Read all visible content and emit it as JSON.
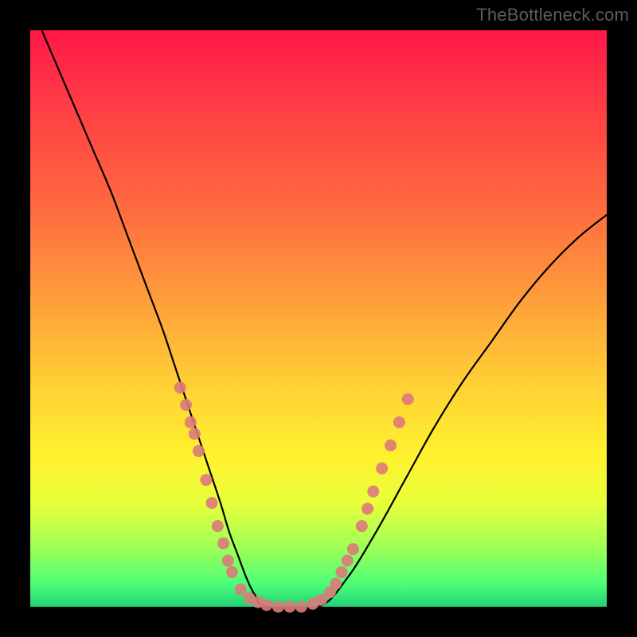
{
  "watermark": "TheBottleneck.com",
  "colors": {
    "frame": "#000000",
    "gradient_top": "#ff1848",
    "gradient_bottom": "#22d276",
    "curve": "#000000",
    "marker": "#db7a7a"
  },
  "chart_data": {
    "type": "line",
    "title": "",
    "xlabel": "",
    "ylabel": "",
    "xlim": [
      0,
      100
    ],
    "ylim": [
      0,
      100
    ],
    "series": [
      {
        "name": "curve",
        "x": [
          2,
          5,
          8,
          11,
          14,
          17,
          20,
          23,
          25,
          27,
          29,
          31,
          33,
          34.5,
          36,
          37.5,
          39,
          41,
          50,
          55,
          60,
          65,
          70,
          75,
          80,
          85,
          90,
          95,
          100
        ],
        "y": [
          100,
          93,
          86,
          79,
          72,
          64,
          56,
          48,
          42,
          36,
          30,
          24,
          18,
          13,
          9,
          5,
          2,
          0,
          0,
          5,
          13,
          22,
          31,
          39,
          46,
          53,
          59,
          64,
          68
        ]
      }
    ],
    "markers": [
      {
        "x": 26.0,
        "y": 38
      },
      {
        "x": 27.0,
        "y": 35
      },
      {
        "x": 27.8,
        "y": 32
      },
      {
        "x": 28.5,
        "y": 30
      },
      {
        "x": 29.2,
        "y": 27
      },
      {
        "x": 30.5,
        "y": 22
      },
      {
        "x": 31.5,
        "y": 18
      },
      {
        "x": 32.5,
        "y": 14
      },
      {
        "x": 33.5,
        "y": 11
      },
      {
        "x": 34.3,
        "y": 8
      },
      {
        "x": 35.0,
        "y": 6
      },
      {
        "x": 36.5,
        "y": 3
      },
      {
        "x": 38.0,
        "y": 1.5
      },
      {
        "x": 39.5,
        "y": 0.8
      },
      {
        "x": 41.0,
        "y": 0.3
      },
      {
        "x": 43.0,
        "y": 0
      },
      {
        "x": 45.0,
        "y": 0
      },
      {
        "x": 47.0,
        "y": 0
      },
      {
        "x": 49.0,
        "y": 0.5
      },
      {
        "x": 50.5,
        "y": 1.2
      },
      {
        "x": 52.0,
        "y": 2.5
      },
      {
        "x": 53.0,
        "y": 4
      },
      {
        "x": 54.0,
        "y": 6
      },
      {
        "x": 55.0,
        "y": 8
      },
      {
        "x": 56.0,
        "y": 10
      },
      {
        "x": 57.5,
        "y": 14
      },
      {
        "x": 58.5,
        "y": 17
      },
      {
        "x": 59.5,
        "y": 20
      },
      {
        "x": 61.0,
        "y": 24
      },
      {
        "x": 62.5,
        "y": 28
      },
      {
        "x": 64.0,
        "y": 32
      },
      {
        "x": 65.5,
        "y": 36
      }
    ]
  }
}
